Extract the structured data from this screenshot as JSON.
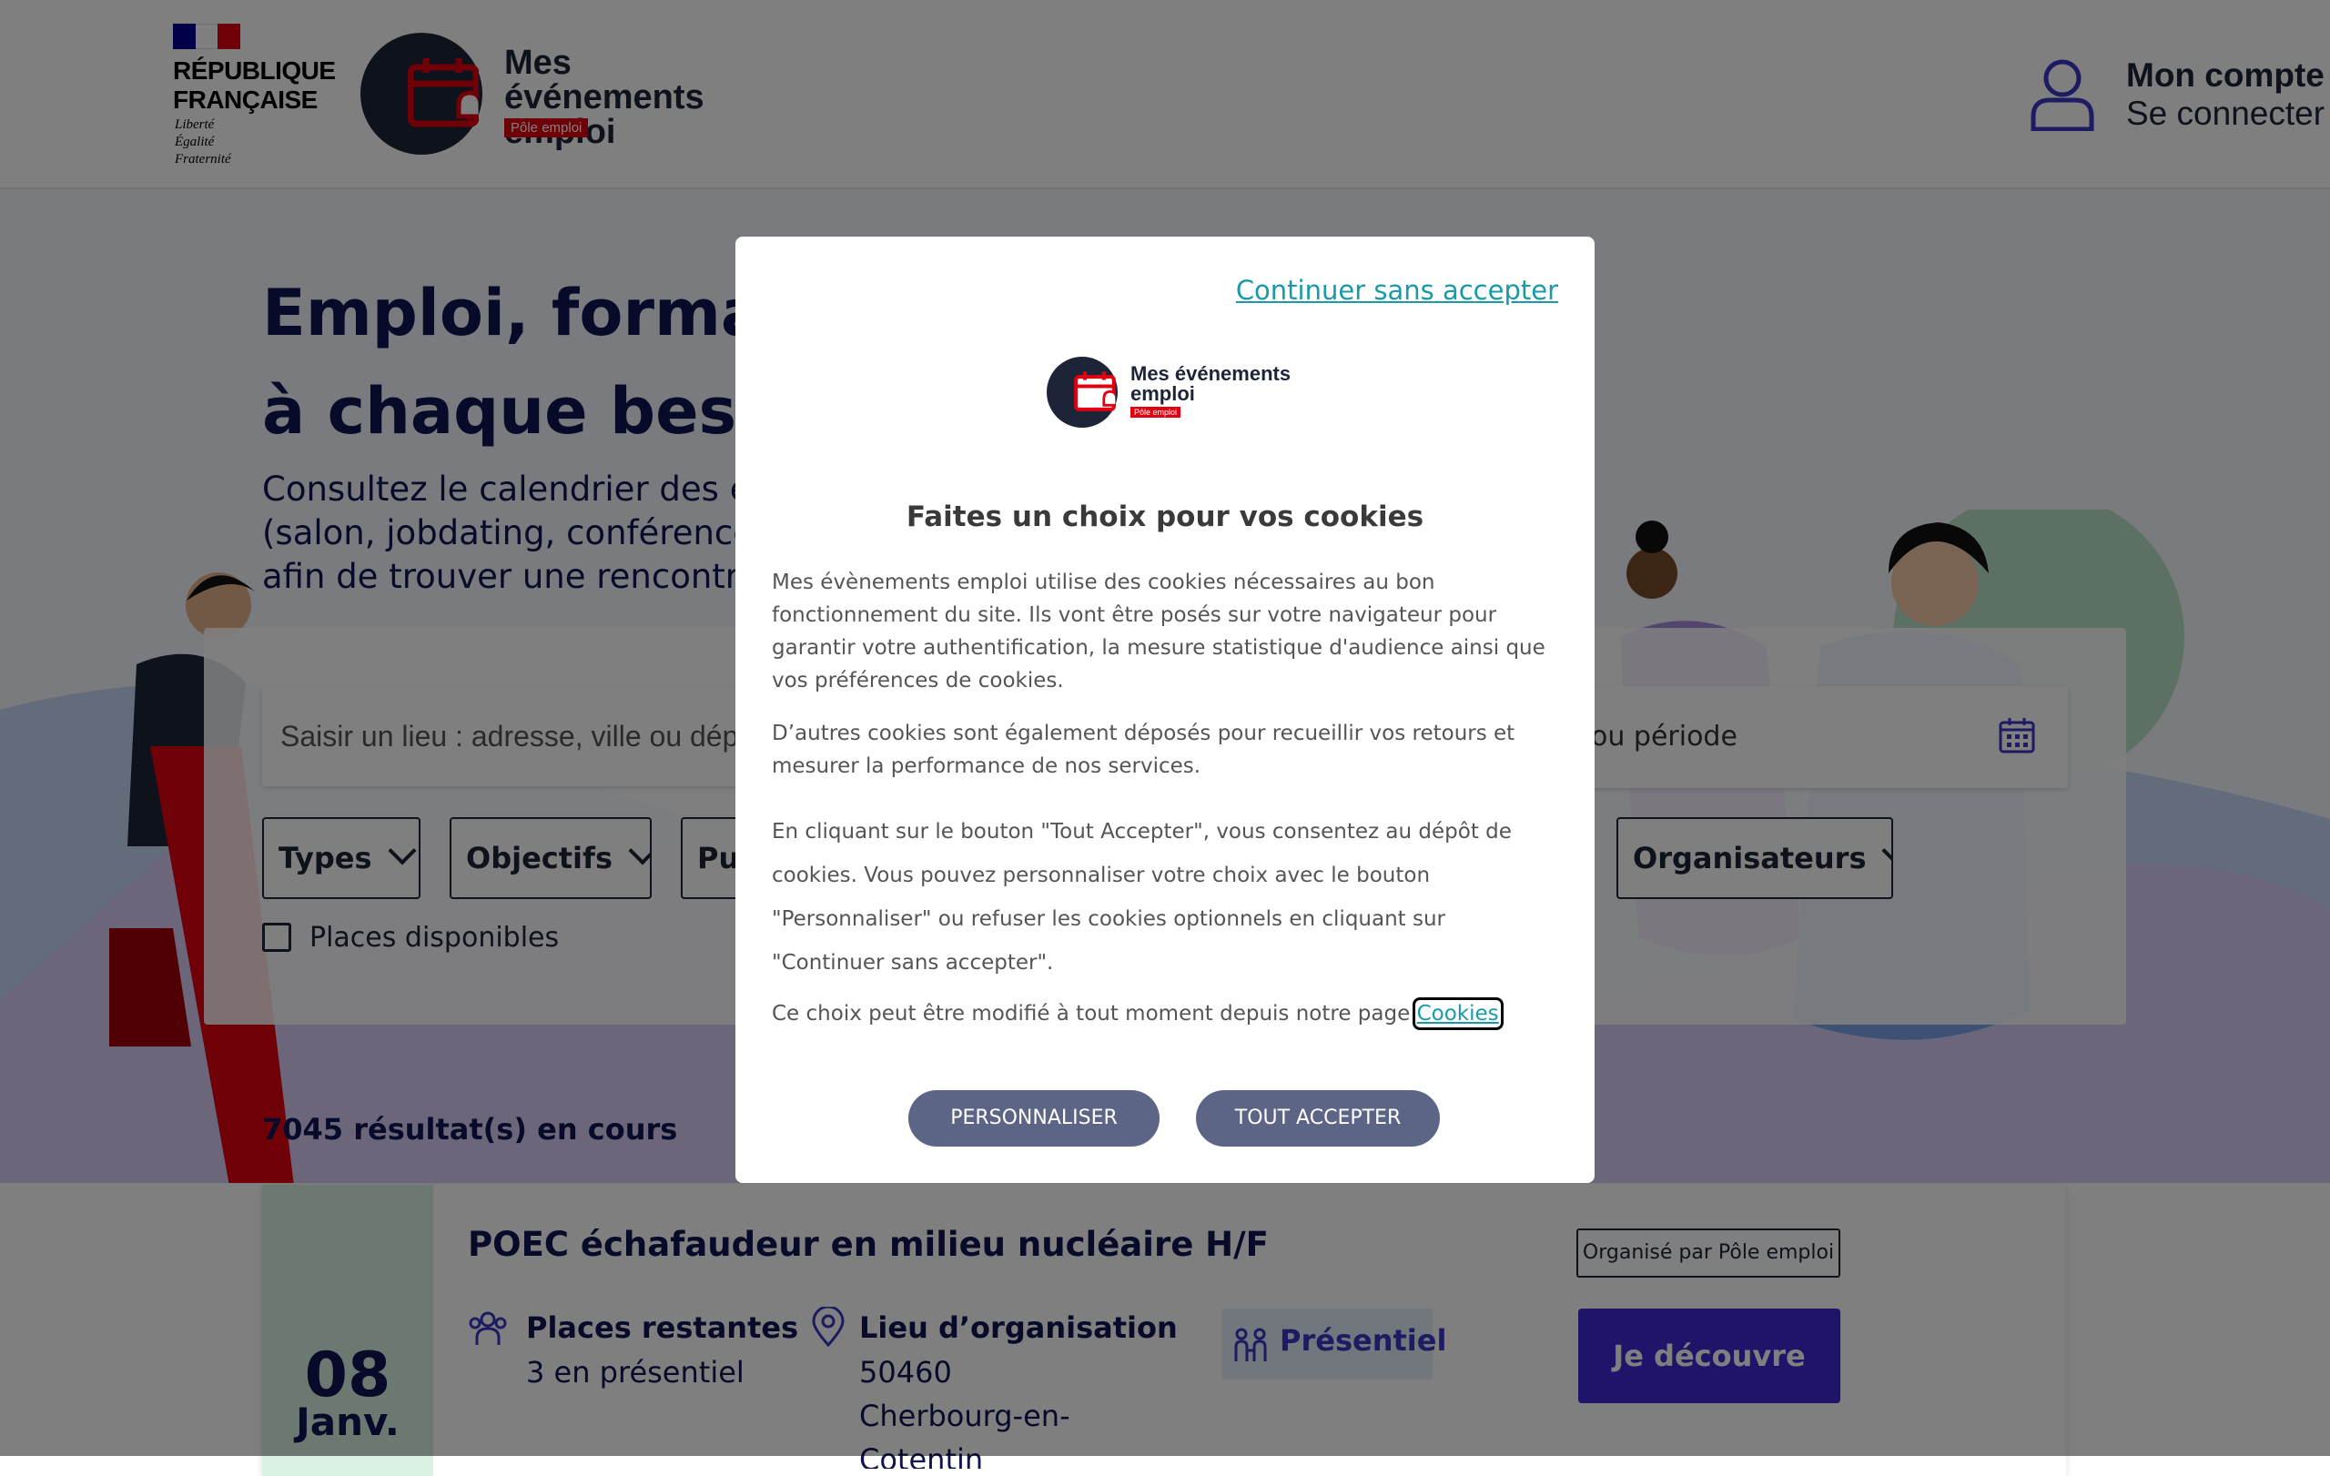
{
  "header": {
    "republic": {
      "title": "RÉPUBLIQUE\nFRANÇAISE",
      "motto": "Liberté\nÉgalité\nFraternité"
    },
    "app_logo": {
      "name": "Mes événements\nemploi",
      "badge": "Pôle emploi"
    },
    "account": {
      "title": "Mon compte",
      "subtitle": "Se connecter",
      "icon": "user-icon"
    }
  },
  "hero": {
    "title": "Emploi, format\nà chaque besoi",
    "subtitle": "Consultez le calendrier des é\n(salon, jobdating, conférence\nafin de trouver une rencontre"
  },
  "search": {
    "location_placeholder": "Saisir un lieu : adresse, ville ou dép",
    "date_placeholder": "e ou période",
    "filters": [
      "Types",
      "Objectifs",
      "Pu",
      "Organisateurs"
    ],
    "available_places_label": "Places disponibles"
  },
  "results": {
    "count_text": "7045 résultat(s) en cours"
  },
  "event_card": {
    "day": "08",
    "month": "Janv.",
    "title": "POEC échafaudeur en milieu nucléaire H/F",
    "places_label": "Places restantes",
    "places_value": "3 en présentiel",
    "location_label": "Lieu d’organisation",
    "location_value": "50460\nCherbourg-en-\nCotentin",
    "mode": "Présentiel",
    "organizer": "Organisé par Pôle emploi",
    "cta": "Je découvre"
  },
  "cookie_modal": {
    "skip_link": "Continuer sans accepter",
    "logo_name": "Mes événements\nemploi",
    "logo_badge": "Pôle emploi",
    "title": "Faites un choix pour vos cookies",
    "paragraph1": "Mes évènements emploi utilise des cookies nécessaires au bon fonctionnement du site. Ils vont être posés sur votre navigateur pour garantir votre authentification, la mesure statistique d'audience ainsi que vos préférences de cookies.",
    "paragraph2": "D’autres cookies sont également déposés pour recueillir vos retours et mesurer la performance de nos services.",
    "paragraph3": "En cliquant sur le bouton \"Tout Accepter\", vous consentez au dépôt de cookies. Vous pouvez personnaliser votre choix avec le bouton \"Personnaliser\" ou refuser les cookies optionnels en cliquant sur \"Continuer sans accepter\".",
    "paragraph4": "Ce choix peut être modifié à tout moment depuis notre page ",
    "cookies_link": "Cookies",
    "personalize_button": "PERSONNALISER",
    "accept_button": "TOUT ACCEPTER"
  },
  "colors": {
    "navy": "#0f1450",
    "marianne_blue": "#000091",
    "marianne_red": "#e1000f",
    "teal_link": "#1a9aa8",
    "modal_button": "#5c6585",
    "cta_purple": "#3d2bd6"
  }
}
